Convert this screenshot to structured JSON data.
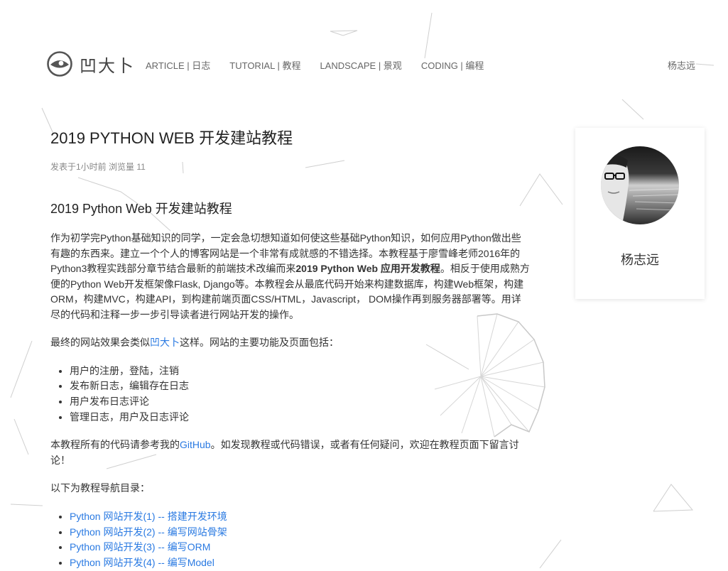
{
  "site": {
    "logo_text": "凹大卜"
  },
  "nav": [
    {
      "label": "ARTICLE | 日志"
    },
    {
      "label": "TUTORIAL | 教程"
    },
    {
      "label": "LANDSCAPE | 景观"
    },
    {
      "label": "CODING | 编程"
    }
  ],
  "user": {
    "name": "杨志远"
  },
  "article": {
    "title": "2019 PYTHON WEB 开发建站教程",
    "meta": "发表于1小时前 浏览量 11",
    "subtitle": "2019 Python Web 开发建站教程",
    "intro_part1": "作为初学完Python基础知识的同学，一定会急切想知道如何使这些基础Python知识，如何应用Python做出些有趣的东西来。建立一个个人的博客网站是一个非常有成就感的不错选择。本教程基于廖雪峰老师2016年的Python3教程实践部分章节结合最新的前端技术改编而来",
    "intro_bold": "2019 Python Web 应用开发教程",
    "intro_part2": "。相反于使用成熟方便的Python Web开发框架像Flask, Django等。本教程会从最底代码开始来构建数据库，构建Web框架，构建ORM，构建MVC，构建API，到构建前端页面CSS/HTML，Javascript， DOM操作再到服务器部署等。用详尽的代码和注释一步一步引导读者进行网站开发的操作。",
    "effect_before": "最终的网站效果会类似",
    "effect_link": "凹大卜",
    "effect_after": "这样。网站的主要功能及页面包括：",
    "features": [
      "用户的注册，登陆，注销",
      "发布新日志，编辑存在日志",
      "用户发布日志评论",
      "管理日志，用户及日志评论"
    ],
    "code_before": "本教程所有的代码请参考我的",
    "code_link": "GitHub",
    "code_after": "。如发现教程或代码错误，或者有任何疑问，欢迎在教程页面下留言讨论！",
    "toc_label": "以下为教程导航目录：",
    "toc": [
      "Python 网站开发(1) -- 搭建开发环境",
      "Python 网站开发(2) -- 编写网站骨架",
      "Python 网站开发(3) -- 编写ORM",
      "Python 网站开发(4) -- 编写Model"
    ]
  },
  "profile": {
    "name": "杨志远"
  },
  "colors": {
    "link": "#2a7ae2",
    "text": "#333333",
    "muted": "#888888",
    "decor_lines": "#d0d0d0"
  }
}
